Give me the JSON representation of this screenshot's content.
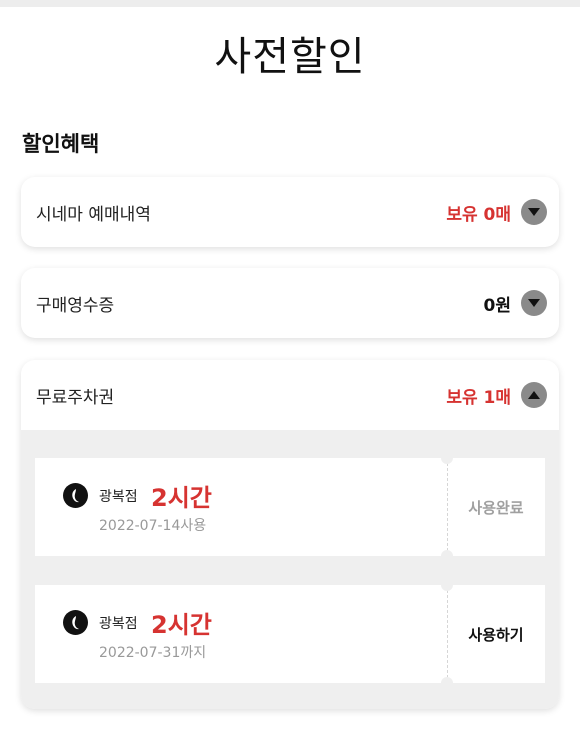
{
  "page": {
    "title": "사전할인"
  },
  "section": {
    "title": "할인혜택"
  },
  "items": [
    {
      "label": "시네마 예매내역",
      "value": "보유 0매",
      "value_color": "#d63331",
      "toggle_icon": "chevron-down-icon"
    },
    {
      "label": "구매영수증",
      "value": "0원",
      "value_color": "#111111",
      "toggle_icon": "chevron-down-icon"
    },
    {
      "label": "무료주차권",
      "value": "보유 1매",
      "value_color": "#d63331",
      "toggle_icon": "chevron-up-icon",
      "expanded": true
    }
  ],
  "coupons": [
    {
      "logo_icon": "lotte-logo-icon",
      "branch": "광복점",
      "duration": "2시간",
      "date": "2022-07-14사용",
      "action": "사용완료",
      "state": "used"
    },
    {
      "logo_icon": "lotte-logo-icon",
      "branch": "광복점",
      "duration": "2시간",
      "date": "2022-07-31까지",
      "action": "사용하기",
      "state": "available"
    }
  ],
  "colors": {
    "accent": "#d63331",
    "muted": "#999999",
    "panel": "#efefef"
  }
}
